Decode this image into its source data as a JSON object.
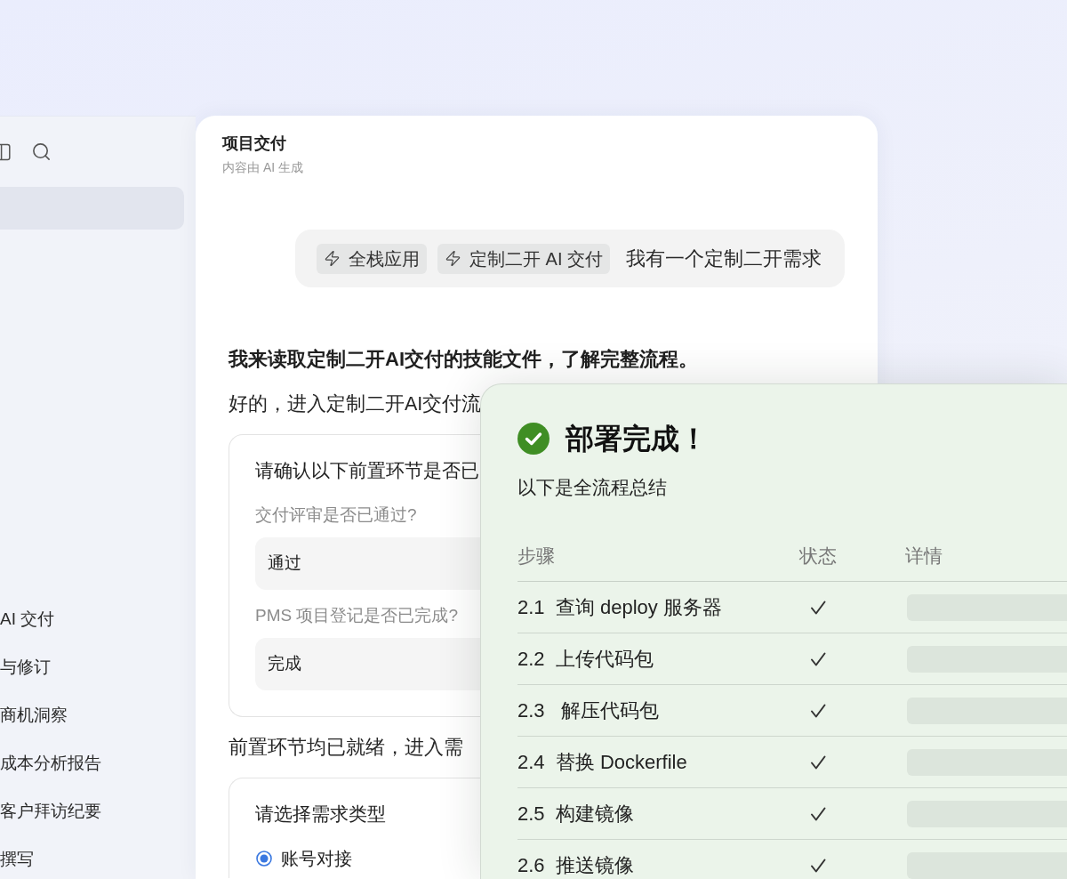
{
  "sidebar": {
    "top_item": {
      "selected": true
    },
    "items": [
      {
        "label": "AI 交付",
        "selected": false
      },
      {
        "label": "与修订",
        "selected": false
      },
      {
        "label": "商机洞察",
        "selected": false
      },
      {
        "label": "成本分析报告",
        "selected": false
      },
      {
        "label": "客户拜访纪要",
        "selected": false
      },
      {
        "label": "撰写",
        "selected": false
      }
    ]
  },
  "chat": {
    "title": "项目交付",
    "subtitle": "内容由 AI 生成",
    "user_message": {
      "chips": [
        "全栈应用",
        "定制二开 AI 交付"
      ],
      "text": "我有一个定制二开需求"
    },
    "messages": [
      {
        "kind": "bold",
        "text": "我来读取定制二开AI交付的技能文件，了解完整流程。"
      },
      {
        "kind": "plain",
        "text": "好的，进入定制二开AI交付流"
      },
      {
        "kind": "form",
        "title": "请确认以下前置环节是否已",
        "questions": [
          {
            "label": "交付评审是否已通过?",
            "value": "通过"
          },
          {
            "label": "PMS 项目登记是否已完成?",
            "value": "完成"
          }
        ]
      },
      {
        "kind": "plain",
        "text": "前置环节均已就绪，进入需"
      },
      {
        "kind": "choice",
        "title": "请选择需求类型",
        "options": [
          {
            "label": "账号对接",
            "selected": true
          }
        ]
      }
    ]
  },
  "summary": {
    "title": "部署完成！",
    "subtitle": "以下是全流程总结",
    "columns": [
      "步骤",
      "状态",
      "详情"
    ],
    "rows": [
      {
        "step": "2.1  查询 deploy 服务器",
        "done": true
      },
      {
        "step": "2.2  上传代码包",
        "done": true
      },
      {
        "step": "2.3   解压代码包",
        "done": true
      },
      {
        "step": "2.4  替换 Dockerfile",
        "done": true
      },
      {
        "step": "2.5  构建镜像",
        "done": true
      },
      {
        "step": "2.6  推送镜像",
        "done": true
      }
    ]
  }
}
